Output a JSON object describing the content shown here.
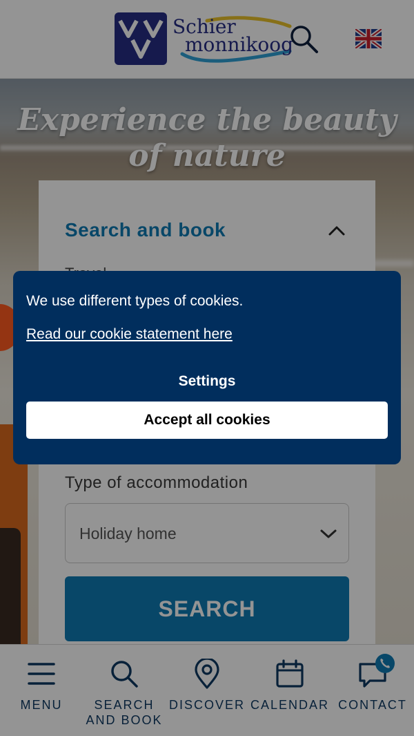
{
  "header": {
    "logo_brand": "VVV",
    "logo_line1": "Schier",
    "logo_line2": "monnikoog",
    "search_icon": "search-icon",
    "language_flag": "uk-flag-icon"
  },
  "hero": {
    "title": "Experience the beauty of nature"
  },
  "search_card": {
    "title": "Search and book",
    "travel_label": "Travel",
    "accommodation_label": "Type of accommodation",
    "accommodation_value": "Holiday home",
    "search_button": "SEARCH"
  },
  "cookie_banner": {
    "message": "We use different types of cookies.",
    "link_text": "Read our cookie statement here",
    "settings_label": "Settings",
    "accept_label": "Accept all cookies"
  },
  "bottom_nav": {
    "items": [
      {
        "label": "MENU",
        "icon": "menu-icon"
      },
      {
        "label": "SEARCH\nAND BOOK",
        "icon": "search-icon"
      },
      {
        "label": "DISCOVER",
        "icon": "map-pin-icon"
      },
      {
        "label": "CALENDAR",
        "icon": "calendar-icon"
      },
      {
        "label": "CONTACT",
        "icon": "chat-icon"
      }
    ]
  },
  "colors": {
    "brand_blue": "#0e7ab4",
    "navy": "#012e5d",
    "logo_navy": "#262e86"
  }
}
